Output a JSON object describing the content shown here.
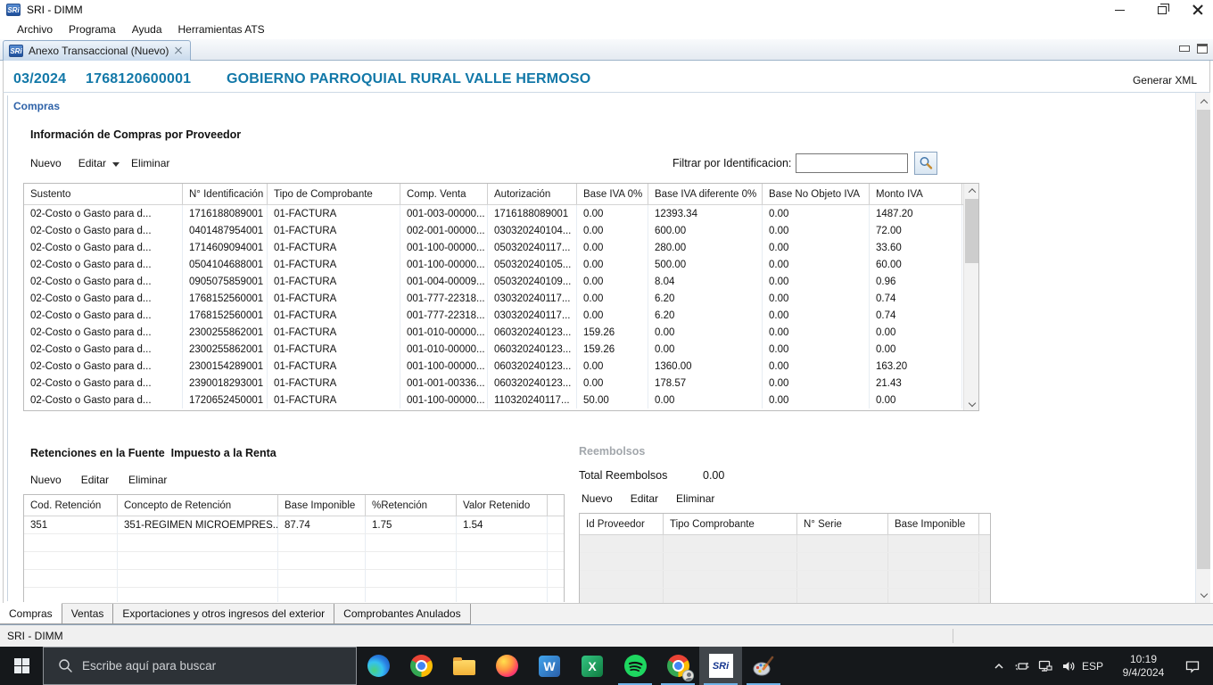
{
  "window": {
    "title": "SRI - DIMM",
    "menu": [
      "Archivo",
      "Programa",
      "Ayuda",
      "Herramientas ATS"
    ],
    "tab_label": "Anexo Transaccional (Nuevo)"
  },
  "header": {
    "period": "03/2024",
    "ruc": "1768120600001",
    "entity": "GOBIERNO PARROQUIAL RURAL VALLE HERMOSO",
    "generate_xml": "Generar XML"
  },
  "compras": {
    "section_label": "Compras",
    "title": "Información de Compras por Proveedor",
    "toolbar": {
      "nuevo": "Nuevo",
      "editar": "Editar",
      "eliminar": "Eliminar"
    },
    "filter_label": "Filtrar por Identificacion:",
    "filter_value": "",
    "columns": [
      "Sustento",
      "N° Identificación",
      "Tipo de Comprobante",
      "Comp. Venta",
      "Autorización",
      "Base IVA 0%",
      "Base IVA diferente 0%",
      "Base No Objeto IVA",
      "Monto IVA"
    ],
    "rows": [
      [
        "02-Costo o Gasto para d...",
        "1716188089001",
        "01-FACTURA",
        "001-003-00000...",
        "1716188089001",
        "0.00",
        "12393.34",
        "0.00",
        "1487.20"
      ],
      [
        "02-Costo o Gasto para d...",
        "0401487954001",
        "01-FACTURA",
        "002-001-00000...",
        "030320240104...",
        "0.00",
        "600.00",
        "0.00",
        "72.00"
      ],
      [
        "02-Costo o Gasto para d...",
        "1714609094001",
        "01-FACTURA",
        "001-100-00000...",
        "050320240117...",
        "0.00",
        "280.00",
        "0.00",
        "33.60"
      ],
      [
        "02-Costo o Gasto para d...",
        "0504104688001",
        "01-FACTURA",
        "001-100-00000...",
        "050320240105...",
        "0.00",
        "500.00",
        "0.00",
        "60.00"
      ],
      [
        "02-Costo o Gasto para d...",
        "0905075859001",
        "01-FACTURA",
        "001-004-00009...",
        "050320240109...",
        "0.00",
        "8.04",
        "0.00",
        "0.96"
      ],
      [
        "02-Costo o Gasto para d...",
        "1768152560001",
        "01-FACTURA",
        "001-777-22318...",
        "030320240117...",
        "0.00",
        "6.20",
        "0.00",
        "0.74"
      ],
      [
        "02-Costo o Gasto para d...",
        "1768152560001",
        "01-FACTURA",
        "001-777-22318...",
        "030320240117...",
        "0.00",
        "6.20",
        "0.00",
        "0.74"
      ],
      [
        "02-Costo o Gasto para d...",
        "2300255862001",
        "01-FACTURA",
        "001-010-00000...",
        "060320240123...",
        "159.26",
        "0.00",
        "0.00",
        "0.00"
      ],
      [
        "02-Costo o Gasto para d...",
        "2300255862001",
        "01-FACTURA",
        "001-010-00000...",
        "060320240123...",
        "159.26",
        "0.00",
        "0.00",
        "0.00"
      ],
      [
        "02-Costo o Gasto para d...",
        "2300154289001",
        "01-FACTURA",
        "001-100-00000...",
        "060320240123...",
        "0.00",
        "1360.00",
        "0.00",
        "163.20"
      ],
      [
        "02-Costo o Gasto para d...",
        "2390018293001",
        "01-FACTURA",
        "001-001-00336...",
        "060320240123...",
        "0.00",
        "178.57",
        "0.00",
        "21.43"
      ],
      [
        "02-Costo o Gasto para d...",
        "1720652450001",
        "01-FACTURA",
        "001-100-00000...",
        "110320240117...",
        "50.00",
        "0.00",
        "0.00",
        "0.00"
      ]
    ]
  },
  "retenciones": {
    "title": "Retenciones en la Fuente  Impuesto a la Renta",
    "toolbar": {
      "nuevo": "Nuevo",
      "editar": "Editar",
      "eliminar": "Eliminar"
    },
    "columns": [
      "Cod. Retención",
      "Concepto de Retención",
      "Base Imponible",
      "%Retención",
      "Valor Retenido"
    ],
    "rows": [
      [
        "351",
        "351-REGIMEN MICROEMPRES...",
        "87.74",
        "1.75",
        "1.54"
      ]
    ]
  },
  "reembolsos": {
    "title": "Reembolsos",
    "total_label": "Total Reembolsos",
    "total_value": "0.00",
    "toolbar": {
      "nuevo": "Nuevo",
      "editar": "Editar",
      "eliminar": "Eliminar"
    },
    "columns": [
      "Id Proveedor",
      "Tipo Comprobante",
      "N° Serie",
      "Base Imponible"
    ]
  },
  "page_tabs": [
    "Compras",
    "Ventas",
    "Exportaciones y otros ingresos del exterior",
    "Comprobantes Anulados"
  ],
  "status_text": "SRI - DIMM",
  "taskbar": {
    "search_placeholder": "Escribe aquí para buscar",
    "tray": {
      "language": "ESP",
      "time": "10:19",
      "date": "9/4/2024"
    }
  },
  "colors": {
    "header_text": "#1278a8",
    "section_label": "#2e62a8",
    "running_underline": "#6fb3e8"
  }
}
